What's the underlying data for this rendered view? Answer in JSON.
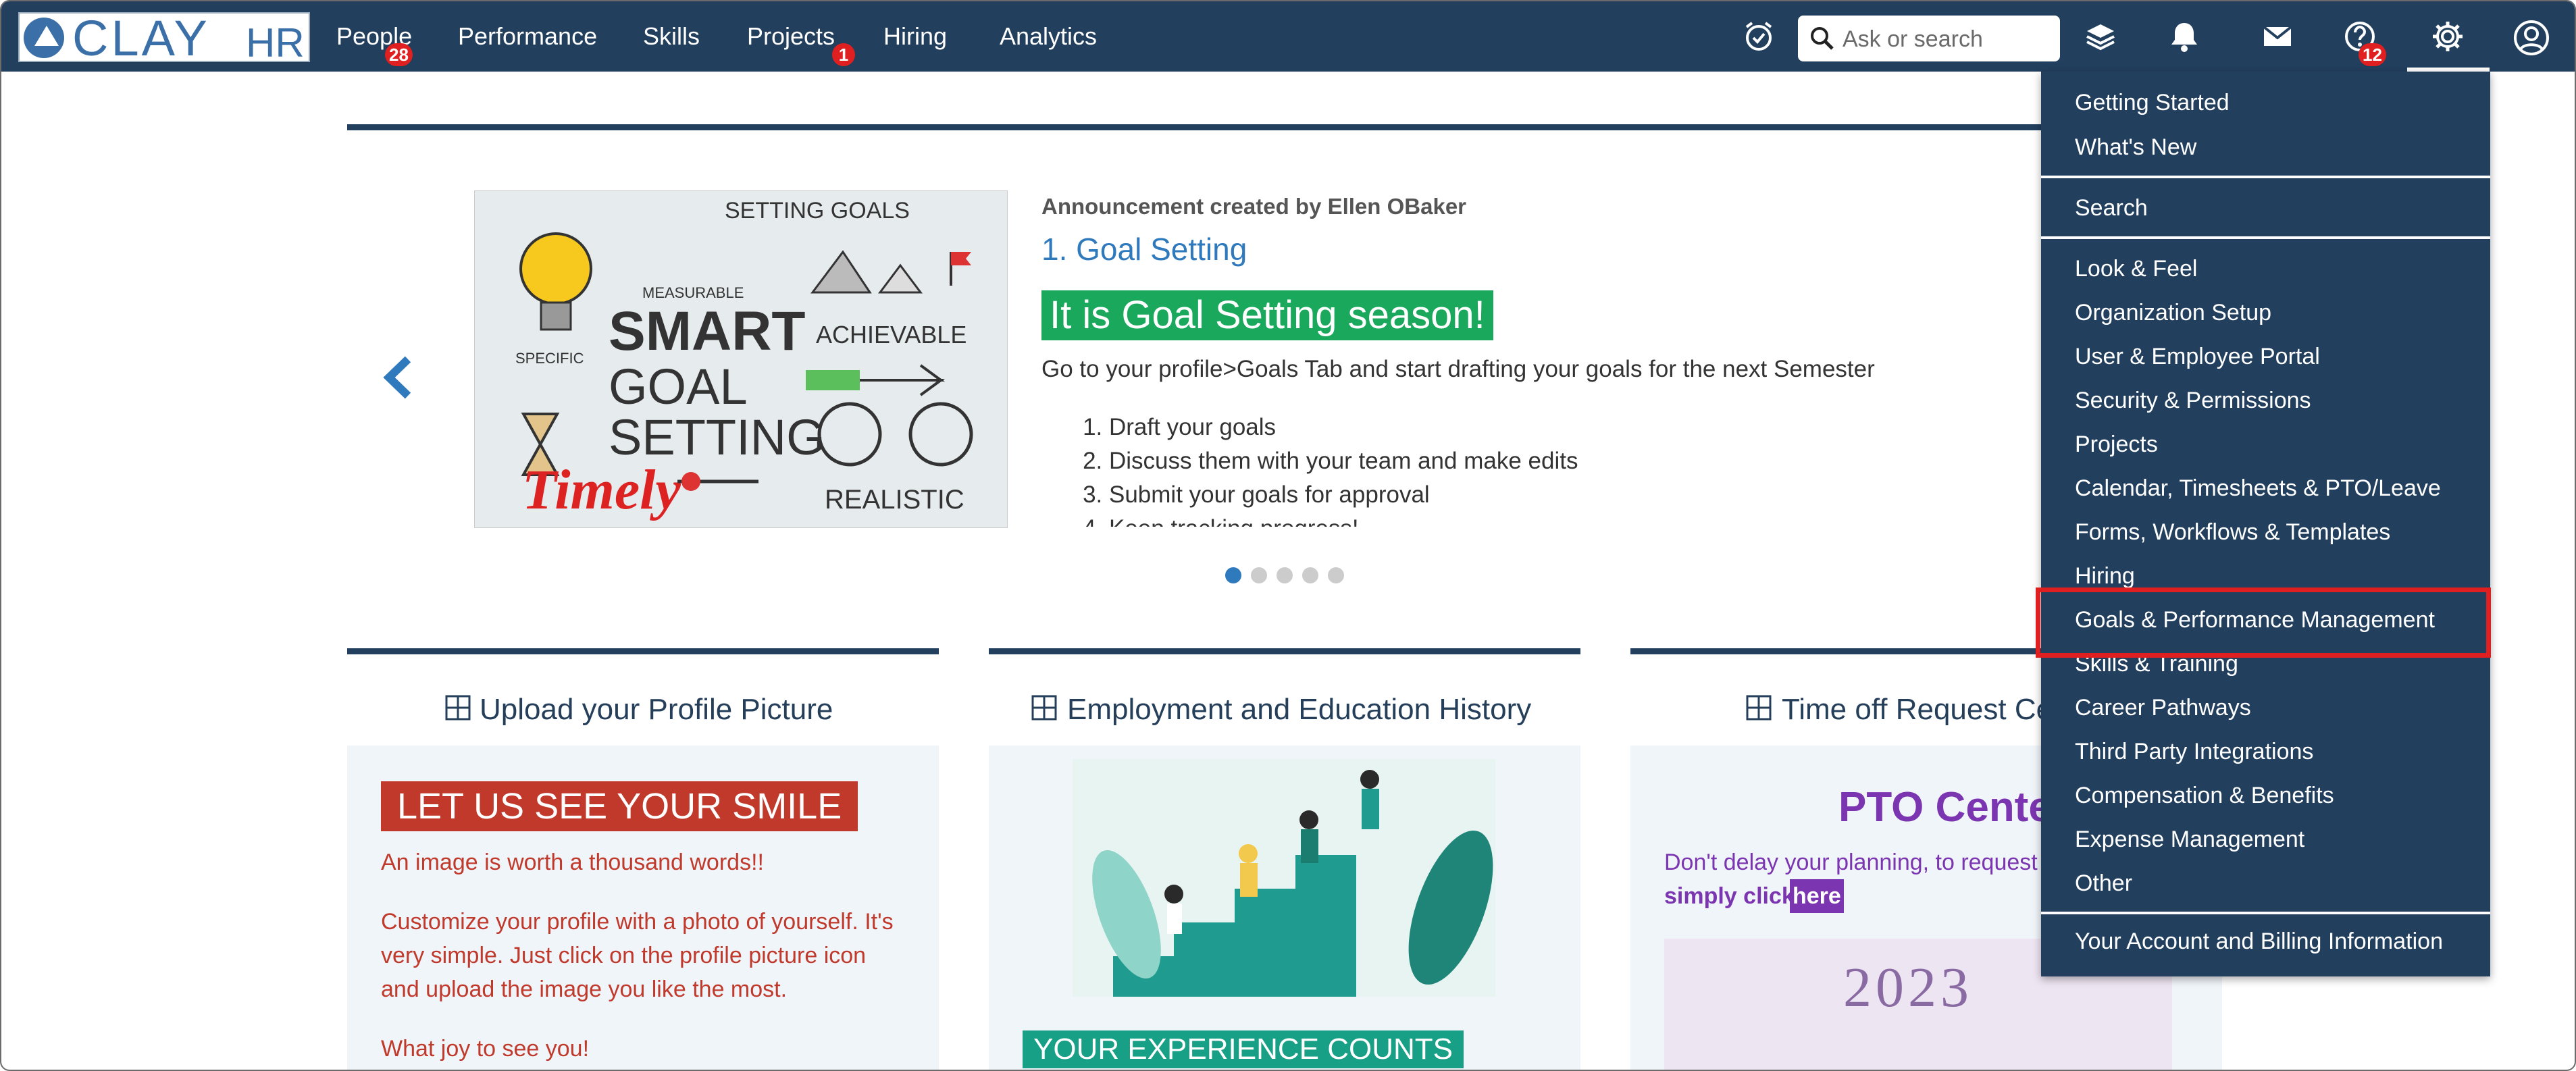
{
  "app": {
    "logo_main": "CLAY",
    "logo_sub": "HR"
  },
  "nav": {
    "items": [
      {
        "label": "People",
        "badge": "28"
      },
      {
        "label": "Performance"
      },
      {
        "label": "Skills"
      },
      {
        "label": "Projects",
        "badge": "1"
      },
      {
        "label": "Hiring"
      },
      {
        "label": "Analytics"
      }
    ],
    "search_placeholder": "Ask or search",
    "help_badge": "12",
    "icons": [
      "checkin-icon",
      "search-icon",
      "layers-icon",
      "bell-icon",
      "mail-icon",
      "help-icon",
      "gear-icon",
      "user-icon"
    ]
  },
  "announcement": {
    "created_by": "Announcement created by Ellen OBaker",
    "title": "1. Goal Setting",
    "headline": "It is Goal Setting season!",
    "body": "Go to your profile>Goals Tab and start drafting your goals for the next Semester",
    "steps": [
      "Draft your goals",
      "Discuss them with your team and make edits",
      "Submit your goals for approval",
      "Keep tracking progress!"
    ],
    "image_words": {
      "top": "SETTING GOALS",
      "measurable": "MEASURABLE",
      "specific": "SPECIFIC",
      "smart": "SMART",
      "goal": "GOAL",
      "setting": "SETTING",
      "achievable": "ACHIEVABLE",
      "realistic": "REALISTIC",
      "timely": "Timely"
    },
    "slide_count": 5,
    "active_slide": 1
  },
  "cards": [
    {
      "title": "Upload your Profile Picture",
      "banner": "LET US SEE YOUR SMILE",
      "lines": [
        "An image is worth a thousand words!!",
        "Customize your profile with a photo of yourself. It's",
        "very simple. Just click on the profile picture icon",
        "and upload the image you like the most.",
        "What joy to see you!"
      ]
    },
    {
      "title": "Employment and Education History",
      "banner": "YOUR EXPERIENCE COUNTS"
    },
    {
      "title": "Time off Request Ce",
      "heading": "PTO Center",
      "line1": "Don't delay your planning, to request",
      "line2_prefix": "simply click ",
      "line2_link": "here",
      "year": "2023"
    }
  ],
  "settings_menu": {
    "groups": [
      [
        "Getting Started",
        "What's New"
      ],
      [
        "Search"
      ],
      [
        "Look & Feel",
        "Organization Setup",
        "User & Employee Portal",
        "Security & Permissions",
        "Projects",
        "Calendar, Timesheets & PTO/Leave",
        "Forms, Workflows & Templates",
        "Hiring",
        "Goals & Performance Management",
        "Skills & Training",
        "Career Pathways",
        "Third Party Integrations",
        "Compensation & Benefits",
        "Expense Management",
        "Other"
      ],
      [
        "Your Account and Billing Information"
      ]
    ],
    "highlighted": "Goals & Performance Management"
  },
  "colors": {
    "nav": "#223f5e",
    "accent_blue": "#2f79bd",
    "highlight_red": "#e02020",
    "green": "#1aa85c",
    "purple": "#7b35b0",
    "smile_red": "#c0392b"
  }
}
